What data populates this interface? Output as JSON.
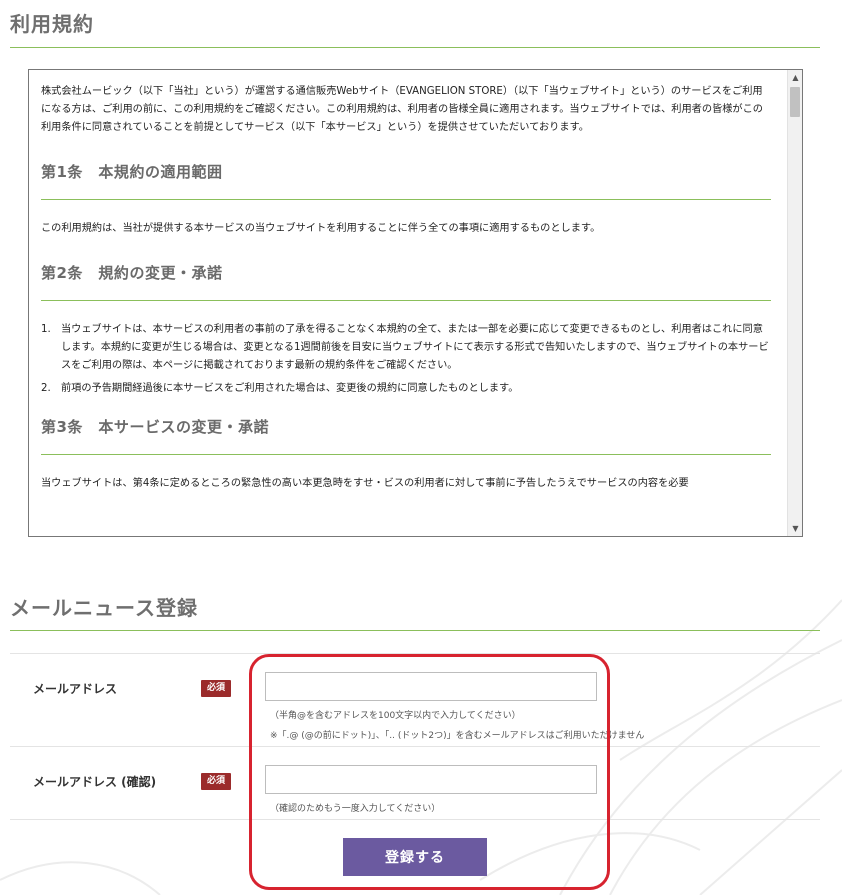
{
  "terms": {
    "heading": "利用規約",
    "intro": "株式会社ムービック（以下「当社」という）が運営する通信販売Webサイト（EVANGELION STORE）（以下「当ウェブサイト」という）のサービスをご利用になる方は、ご利用の前に、この利用規約をご確認ください。この利用規約は、利用者の皆様全員に適用されます。当ウェブサイトでは、利用者の皆様がこの利用条件に同意されていることを前提としてサービス（以下「本サービス」という）を提供させていただいております。",
    "articles": [
      {
        "title": "第1条　本規約の適用範囲",
        "text": "この利用規約は、当社が提供する本サービスの当ウェブサイトを利用することに伴う全ての事項に適用するものとします。"
      },
      {
        "title": "第2条　規約の変更・承諾",
        "items": [
          {
            "num": "1.",
            "text": "当ウェブサイトは、本サービスの利用者の事前の了承を得ることなく本規約の全て、または一部を必要に応じて変更できるものとし、利用者はこれに同意します。本規約に変更が生じる場合は、変更となる1週間前後を目安に当ウェブサイトにて表示する形式で告知いたしますので、当ウェブサイトの本サービスをご利用の際は、本ページに掲載されております最新の規約条件をご確認ください。"
          },
          {
            "num": "2.",
            "text": "前項の予告期間経過後に本サービスをご利用された場合は、変更後の規約に同意したものとします。"
          }
        ]
      },
      {
        "title": "第3条　本サービスの変更・承諾",
        "clipped": "当ウェブサイトは、第4条に定めるところの緊急性の高い本更急時をすせ・ビスの利用者に対して事前に予告したうえでサービスの内容を必要"
      }
    ]
  },
  "mail_news": {
    "heading": "メールニュース登録",
    "rows": [
      {
        "label": "メールアドレス",
        "badge": "必須",
        "value": "",
        "hint1": "（半角@を含むアドレスを100文字以内で入力してください）",
        "hint2": "※「.@ (@の前にドット)」、「.. (ドット2つ)」を含むメールアドレスはご利用いただけません"
      },
      {
        "label": "メールアドレス (確認)",
        "badge": "必須",
        "value": "",
        "hint1": "（確認のためもう一度入力してください）"
      }
    ],
    "submit_label": "登録する"
  },
  "colors": {
    "accent_green": "#8bbf5b",
    "submit_purple": "#6b5aa0",
    "required_red": "#9b2b2b",
    "highlight_red": "#d7232f"
  }
}
